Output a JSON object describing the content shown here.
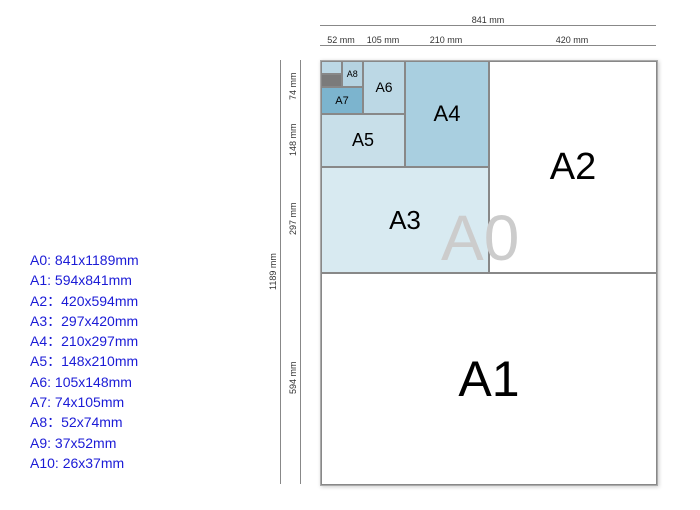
{
  "sizes": [
    {
      "label": "A0: 841x1189mm"
    },
    {
      "label": "A1: 594x841mm"
    },
    {
      "label": "A2：420x594mm"
    },
    {
      "label": "A3：297x420mm"
    },
    {
      "label": "A4：210x297mm"
    },
    {
      "label": "A5：148x210mm"
    },
    {
      "label": "A6: 105x148mm"
    },
    {
      "label": "A7: 74x105mm"
    },
    {
      "label": "A8：52x74mm"
    },
    {
      "label": "A9: 37x52mm"
    },
    {
      "label": "A10: 26x37mm"
    }
  ],
  "rects": {
    "a0": "A0",
    "a1": "A1",
    "a2": "A2",
    "a3": "A3",
    "a4": "A4",
    "a5": "A5",
    "a6": "A6",
    "a7": "A7",
    "a8": "A8"
  },
  "dims": {
    "w841": "841 mm",
    "w420": "420 mm",
    "w210": "210 mm",
    "w105": "105 mm",
    "w52": "52 mm",
    "h1189": "1189 mm",
    "h594": "594 mm",
    "h297": "297 mm",
    "h148": "148 mm",
    "h74": "74 mm"
  }
}
